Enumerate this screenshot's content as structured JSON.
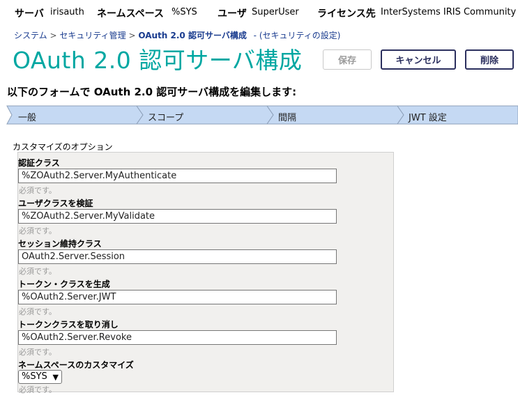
{
  "header": {
    "server_label": "サーバ",
    "server_value": "irisauth",
    "namespace_label": "ネームスペース",
    "namespace_value": "%SYS",
    "user_label": "ユーザ",
    "user_value": "SuperUser",
    "license_label": "ライセンス先",
    "license_value": "InterSystems IRIS Community"
  },
  "breadcrumb": {
    "items": [
      "システム",
      "セキュリティ管理",
      "OAuth 2.0 認可サーバ構成"
    ],
    "separator": ">",
    "suffix": "- (セキュリティの設定)"
  },
  "page_title": "OAuth 2.0 認可サーバ構成",
  "buttons": {
    "save": "保存",
    "cancel": "キャンセル",
    "delete": "削除"
  },
  "subtitle": "以下のフォームで OAuth 2.0 認可サーバ構成を編集します:",
  "tabs": [
    "一般",
    "スコープ",
    "間隔",
    "JWT 設定"
  ],
  "section_label": "カスタマイズのオプション",
  "fields": [
    {
      "label": "認証クラス",
      "value": "%ZOAuth2.Server.MyAuthenticate",
      "hint": "必須です。"
    },
    {
      "label": "ユーザクラスを検証",
      "value": "%ZOAuth2.Server.MyValidate",
      "hint": "必須です。"
    },
    {
      "label": "セッション維持クラス",
      "value": "OAuth2.Server.Session",
      "hint": "必須です。"
    },
    {
      "label": "トークン・クラスを生成",
      "value": "%OAuth2.Server.JWT",
      "hint": "必須です。"
    },
    {
      "label": "トークンクラスを取り消し",
      "value": "%OAuth2.Server.Revoke",
      "hint": "必須です。"
    }
  ],
  "namespace_custom": {
    "label": "ネームスペースのカスタマイズ",
    "value": "%SYS",
    "hint": "必須です。"
  },
  "colors": {
    "title": "#00a7a2",
    "tab_fill": "#c5d9f3",
    "button_border": "#2b2f5e",
    "link": "#1a3c8f"
  }
}
